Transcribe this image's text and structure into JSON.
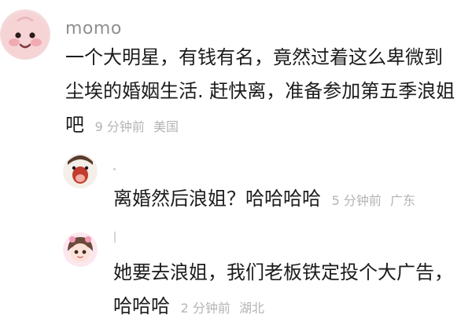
{
  "comments": [
    {
      "username": "momo",
      "text": "一个大明星，有钱有名，竟然过着这么卑微到尘埃的婚姻生活. 赶快离，准备参加第五季浪姐吧",
      "time": "9 分钟前",
      "location": "美国"
    },
    {
      "username": "",
      "text": "离婚然后浪姐？哈哈哈哈",
      "time": "5 分钟前",
      "location": "广东"
    },
    {
      "username": "",
      "text": "她要去浪姐，我们老板铁定投个大广告，哈哈哈",
      "time": "2 分钟前",
      "location": "湖北"
    }
  ],
  "colors": {
    "text": "#1c1c1c",
    "username": "#8f8f8f",
    "meta": "#b4b4b4",
    "background": "#ffffff"
  },
  "icons": {
    "avatar_1": "pink-blob-avatar-icon",
    "avatar_2": "open-mouth-cartoon-avatar-icon",
    "avatar_3": "cartoon-girl-avatar-icon"
  }
}
